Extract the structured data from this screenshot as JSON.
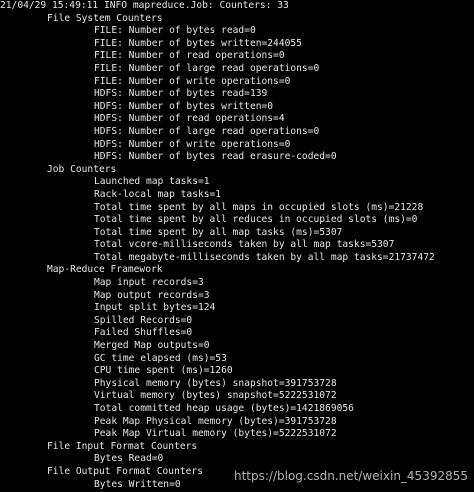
{
  "terminal": {
    "header": "21/04/29 15:49:11 INFO mapreduce.Job: Counters: 33",
    "groups": [
      {
        "name": "File System Counters",
        "items": [
          "FILE: Number of bytes read=0",
          "FILE: Number of bytes written=244055",
          "FILE: Number of read operations=0",
          "FILE: Number of large read operations=0",
          "FILE: Number of write operations=0",
          "HDFS: Number of bytes read=139",
          "HDFS: Number of bytes written=0",
          "HDFS: Number of read operations=4",
          "HDFS: Number of large read operations=0",
          "HDFS: Number of write operations=0",
          "HDFS: Number of bytes read erasure-coded=0"
        ]
      },
      {
        "name": "Job Counters",
        "items": [
          "Launched map tasks=1",
          "Rack-local map tasks=1",
          "Total time spent by all maps in occupied slots (ms)=21228",
          "Total time spent by all reduces in occupied slots (ms)=0",
          "Total time spent by all map tasks (ms)=5307",
          "Total vcore-milliseconds taken by all map tasks=5307",
          "Total megabyte-milliseconds taken by all map tasks=21737472"
        ]
      },
      {
        "name": "Map-Reduce Framework",
        "items": [
          "Map input records=3",
          "Map output records=3",
          "Input split bytes=124",
          "Spilled Records=0",
          "Failed Shuffles=0",
          "Merged Map outputs=0",
          "GC time elapsed (ms)=53",
          "CPU time spent (ms)=1260",
          "Physical memory (bytes) snapshot=391753728",
          "Virtual memory (bytes) snapshot=5222531072",
          "Total committed heap usage (bytes)=1421869056",
          "Peak Map Physical memory (bytes)=391753728",
          "Peak Map Virtual memory (bytes)=5222531072"
        ]
      },
      {
        "name": "File Input Format Counters",
        "items": [
          "Bytes Read=0"
        ]
      },
      {
        "name": "File Output Format Counters",
        "items": [
          "Bytes Written=0"
        ]
      }
    ],
    "watermark": "https://blog.csdn.net/weixin_45392855"
  },
  "colors": {
    "background": "#000000",
    "text": "#e6e6e6"
  }
}
